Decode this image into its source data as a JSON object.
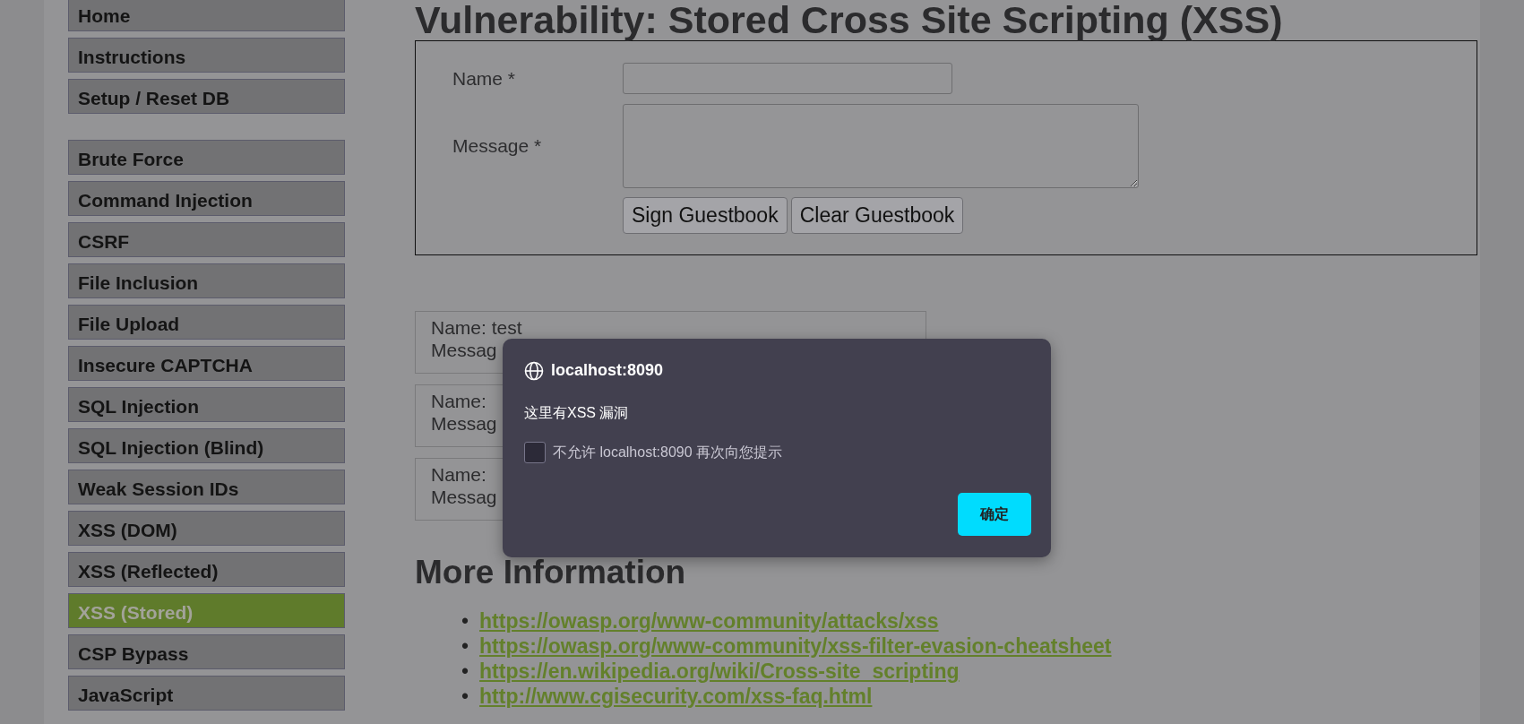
{
  "sidebar": {
    "groups": [
      {
        "items": [
          {
            "label": "Home",
            "selected": false
          },
          {
            "label": "Instructions",
            "selected": false
          },
          {
            "label": "Setup / Reset DB",
            "selected": false
          }
        ]
      },
      {
        "items": [
          {
            "label": "Brute Force",
            "selected": false
          },
          {
            "label": "Command Injection",
            "selected": false
          },
          {
            "label": "CSRF",
            "selected": false
          },
          {
            "label": "File Inclusion",
            "selected": false
          },
          {
            "label": "File Upload",
            "selected": false
          },
          {
            "label": "Insecure CAPTCHA",
            "selected": false
          },
          {
            "label": "SQL Injection",
            "selected": false
          },
          {
            "label": "SQL Injection (Blind)",
            "selected": false
          },
          {
            "label": "Weak Session IDs",
            "selected": false
          },
          {
            "label": "XSS (DOM)",
            "selected": false
          },
          {
            "label": "XSS (Reflected)",
            "selected": false
          },
          {
            "label": "XSS (Stored)",
            "selected": true
          },
          {
            "label": "CSP Bypass",
            "selected": false
          },
          {
            "label": "JavaScript",
            "selected": false
          }
        ]
      }
    ]
  },
  "page_title": "Vulnerability: Stored Cross Site Scripting (XSS)",
  "form": {
    "fields": [
      {
        "label": "Name *",
        "kind": "input"
      },
      {
        "label": "Message *",
        "kind": "textarea"
      }
    ],
    "buttons": [
      "Sign Guestbook",
      "Clear Guestbook"
    ]
  },
  "guestbook_entries": [
    {
      "name_line": "Name: test",
      "message_line": "Messag"
    },
    {
      "name_line": "Name:",
      "message_line": "Messag"
    },
    {
      "name_line": "Name:",
      "message_line": "Messag"
    }
  ],
  "more_information": {
    "heading": "More Information",
    "links": [
      {
        "marker": "•",
        "url": "https://owasp.org/www-community/attacks/xss"
      },
      {
        "marker": "•",
        "url": "https://owasp.org/www-community/xss-filter-evasion-cheatsheet"
      },
      {
        "marker": "•",
        "url": "https://en.wikipedia.org/wiki/Cross-site_scripting"
      },
      {
        "marker": "•",
        "url": "http://www.cgisecurity.com/xss-faq.html"
      }
    ]
  },
  "alert_dialog": {
    "origin": "localhost:8090",
    "message": "这里有XSS 漏洞",
    "checkbox": {
      "label": "不允许 localhost:8090 再次向您提示",
      "checked": false
    },
    "button": "确定"
  }
}
